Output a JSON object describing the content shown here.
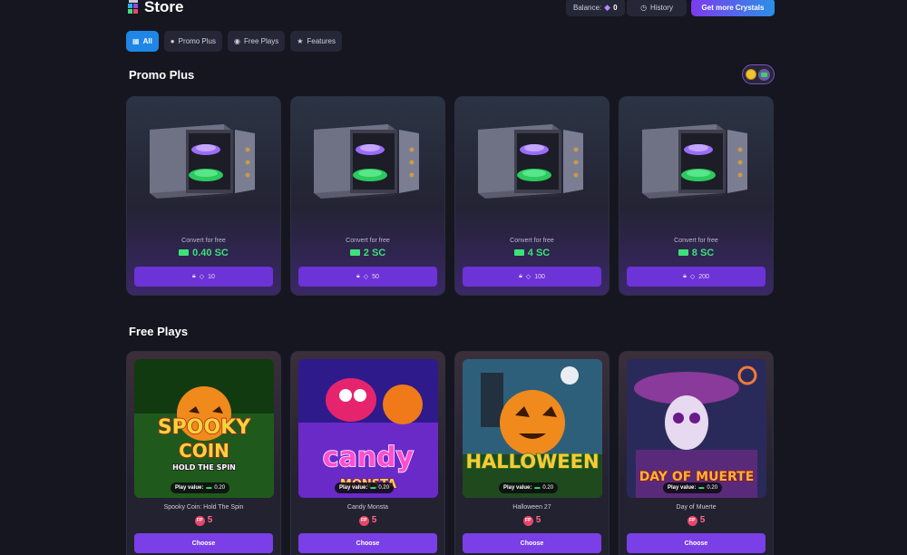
{
  "header": {
    "title": "Store",
    "balance_label": "Balance:",
    "balance_value": "0",
    "history_label": "History",
    "crystals_button": "Get more Crystals"
  },
  "tabs": [
    {
      "label": "All",
      "icon": "grid-icon",
      "active": true
    },
    {
      "label": "Promo Plus",
      "icon": "coin-icon",
      "active": false
    },
    {
      "label": "Free Plays",
      "icon": "ticket-icon",
      "active": false
    },
    {
      "label": "Features",
      "icon": "star-icon",
      "active": false
    }
  ],
  "promo_section": {
    "title": "Promo Plus",
    "cards": [
      {
        "convert_label": "Convert for free",
        "amount": "0.40 SC",
        "price": "10"
      },
      {
        "convert_label": "Convert for free",
        "amount": "2 SC",
        "price": "50"
      },
      {
        "convert_label": "Convert for free",
        "amount": "4 SC",
        "price": "100"
      },
      {
        "convert_label": "Convert for free",
        "amount": "8 SC",
        "price": "200"
      }
    ]
  },
  "free_section": {
    "title": "Free Plays",
    "cards": [
      {
        "name": "Spooky Coin: Hold The Spin",
        "play_value_label": "Play value:",
        "play_value": "0.20",
        "fp_cost": "5",
        "button": "Choose",
        "art_text": [
          "SPOOKY",
          "COIN",
          "HOLD THE SPIN"
        ]
      },
      {
        "name": "Candy Monsta",
        "play_value_label": "Play value:",
        "play_value": "0.20",
        "fp_cost": "5",
        "button": "Choose",
        "art_text": [
          "candy",
          "MONSTA"
        ]
      },
      {
        "name": "Halloween 27",
        "play_value_label": "Play value:",
        "play_value": "0.20",
        "fp_cost": "5",
        "button": "Choose",
        "art_text": [
          "HALLOWEEN"
        ]
      },
      {
        "name": "Day of Muerte",
        "play_value_label": "Play value:",
        "play_value": "0.20",
        "fp_cost": "5",
        "button": "Choose",
        "art_text": [
          "DAY OF MUERTE"
        ]
      }
    ]
  },
  "fp_icon_text": "FP",
  "colors": {
    "background": "#15161f",
    "accent_purple": "#7a3fe6",
    "accent_blue": "#1f86e6",
    "sc_green": "#3ee07a",
    "fp_pink": "#ff6b8a"
  }
}
